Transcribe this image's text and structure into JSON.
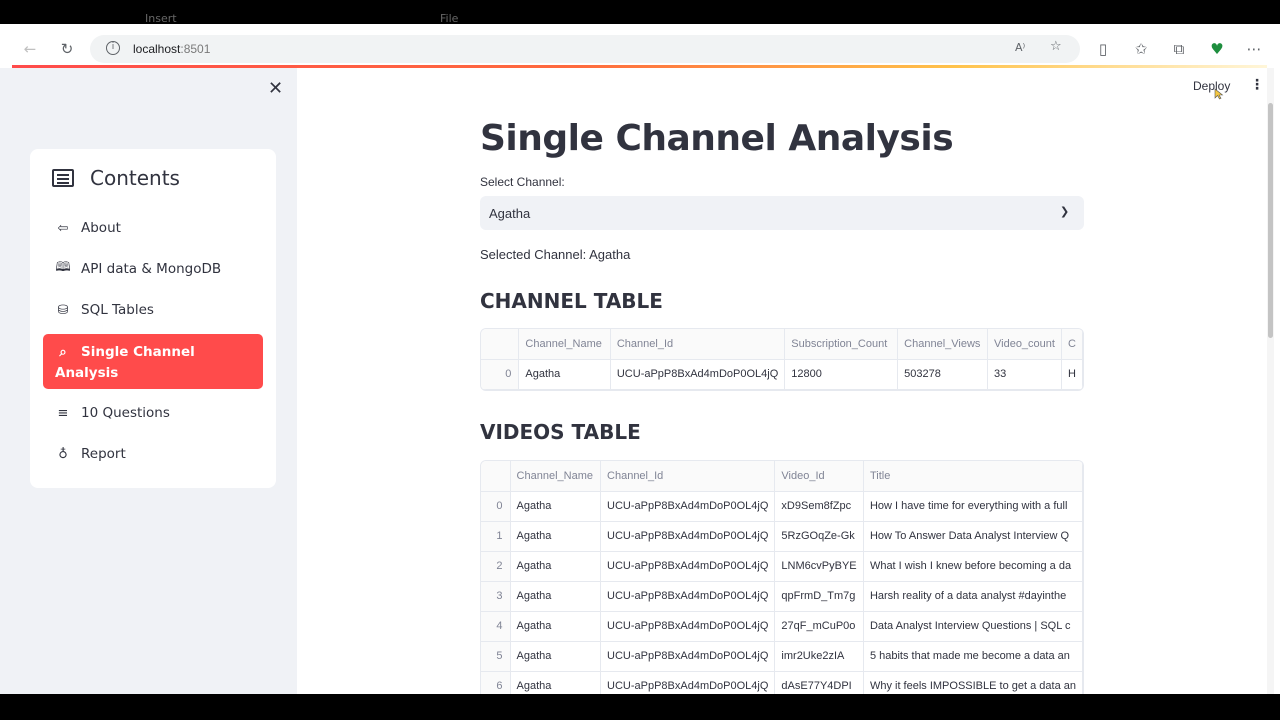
{
  "browser": {
    "url_host": "localhost",
    "url_port": ":8501",
    "ghost_tabs": [
      "Insert",
      "File"
    ]
  },
  "sidebar": {
    "title": "Contents",
    "items": [
      {
        "label": "About",
        "icon": "arrow-left-icon"
      },
      {
        "label": "API data & MongoDB",
        "icon": "book-icon"
      },
      {
        "label": "SQL Tables",
        "icon": "database-icon"
      },
      {
        "label": "Single Channel Analysis",
        "icon": "search-icon",
        "active": true
      },
      {
        "label": "10 Questions",
        "icon": "list-icon"
      },
      {
        "label": "Report",
        "icon": "lightbulb-icon"
      }
    ]
  },
  "header": {
    "deploy_label": "Deploy"
  },
  "main": {
    "title": "Single Channel Analysis",
    "select_label": "Select Channel:",
    "select_value": "Agatha",
    "selected_text": "Selected Channel: Agatha",
    "channel_table": {
      "heading": "CHANNEL TABLE",
      "columns": [
        "",
        "Channel_Name",
        "Channel_Id",
        "Subscription_Count",
        "Channel_Views",
        "Video_count",
        "C"
      ],
      "rows": [
        [
          "0",
          "Agatha",
          "UCU-aPpP8BxAd4mDoP0OL4jQ",
          "12800",
          "503278",
          "33",
          "H"
        ]
      ]
    },
    "videos_table": {
      "heading": "VIDEOS TABLE",
      "columns": [
        "",
        "Channel_Name",
        "Channel_Id",
        "Video_Id",
        "Title"
      ],
      "rows": [
        [
          "0",
          "Agatha",
          "UCU-aPpP8BxAd4mDoP0OL4jQ",
          "xD9Sem8fZpc",
          "How I have time for everything with a full"
        ],
        [
          "1",
          "Agatha",
          "UCU-aPpP8BxAd4mDoP0OL4jQ",
          "5RzGOqZe-Gk",
          "How To Answer Data Analyst Interview Q"
        ],
        [
          "2",
          "Agatha",
          "UCU-aPpP8BxAd4mDoP0OL4jQ",
          "LNM6cvPyBYE",
          "What I wish I knew before becoming a da"
        ],
        [
          "3",
          "Agatha",
          "UCU-aPpP8BxAd4mDoP0OL4jQ",
          "qpFrmD_Tm7g",
          "Harsh reality of a data analyst #dayinthe"
        ],
        [
          "4",
          "Agatha",
          "UCU-aPpP8BxAd4mDoP0OL4jQ",
          "27qF_mCuP0o",
          "Data Analyst Interview Questions | SQL c"
        ],
        [
          "5",
          "Agatha",
          "UCU-aPpP8BxAd4mDoP0OL4jQ",
          "imr2Uke2zIA",
          "5 habits that made me become a data an"
        ],
        [
          "6",
          "Agatha",
          "UCU-aPpP8BxAd4mDoP0OL4jQ",
          "dAsE77Y4DPI",
          "Why it feels IMPOSSIBLE to get a data an"
        ]
      ]
    }
  },
  "colors": {
    "accent": "#ff4b4b",
    "sidebar_bg": "#f0f2f6",
    "text": "#31333f"
  }
}
